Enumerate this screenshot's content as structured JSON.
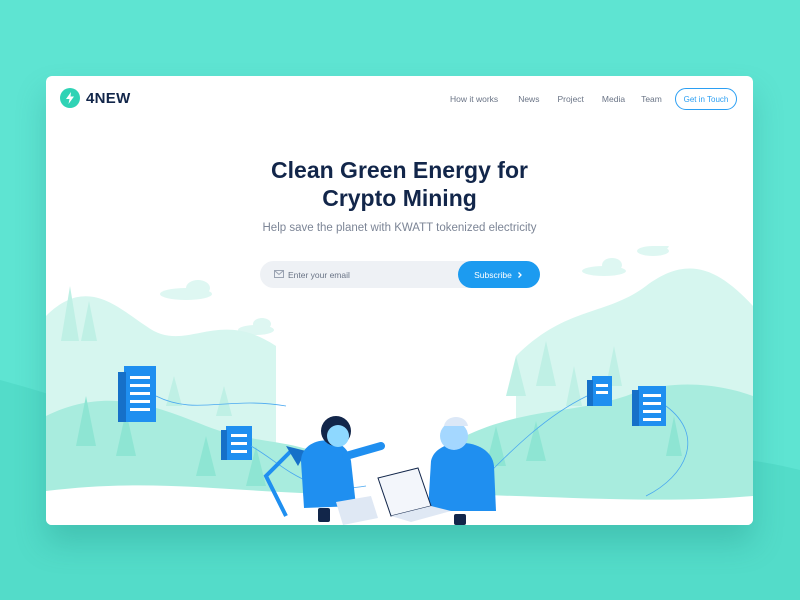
{
  "brand": {
    "name": "4NEW",
    "logo_icon": "lightning-bolt-icon"
  },
  "nav": {
    "links": [
      "How it works",
      "News",
      "Project",
      "Media",
      "Team"
    ],
    "cta_label": "Get in Touch"
  },
  "hero": {
    "title_line1": "Clean Green Energy for",
    "title_line2": "Crypto Mining",
    "subtitle": "Help save the planet with KWATT tokenized electricity"
  },
  "subscribe_form": {
    "email_placeholder": "Enter your email",
    "button_label": "Subscribe",
    "button_icon": "chevron-right-icon"
  },
  "colors": {
    "background": "#5ee4d2",
    "accent": "#1c9bf0",
    "title": "#12264a",
    "logo": "#2fd3b5"
  }
}
